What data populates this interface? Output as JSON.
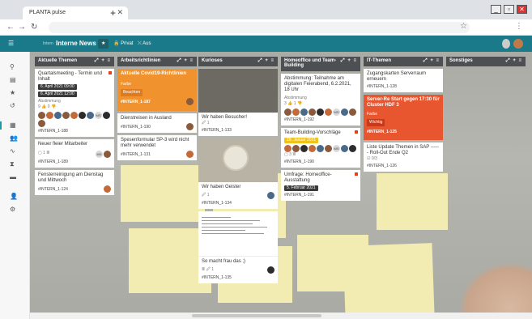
{
  "browser": {
    "tab_title": "PLANTA pulse",
    "tab_close": "✕",
    "new_tab": "+",
    "win_min": "_",
    "win_max": "▫",
    "win_close": "✕"
  },
  "app": {
    "breadcrumb_small": "Intern",
    "breadcrumb_main": "Interne News",
    "star": "★",
    "chip_privat": "🔒 Privat",
    "chip_aus": "⤬ Aus"
  },
  "colors": {
    "header": "#1a7a8a",
    "lane_head": "#4e4f52",
    "orange_card": "#f0922e",
    "red_card": "#e85630"
  },
  "lanes": [
    {
      "title": "Aktuelle Themen",
      "tools": "⤢ + ≡",
      "cards": [
        {
          "title": "Quartalsmeeting - Termin und Inhalt",
          "date1": "6. April 2021 09:00",
          "date2": "6. April 2021 12:00",
          "vote_label": "Abstimmung",
          "votes": "9 👍 0 👎",
          "id": "#INTERN_1-188"
        },
        {
          "title": "Neuer fleier Mitarbeiter",
          "meta": "▢ 1 ≣",
          "id": "#INTERN_1-189"
        },
        {
          "title": "Fensterreinigung am Dienstag und Mittwoch",
          "id": "#INTERN_1-124"
        }
      ]
    },
    {
      "title": "Arbeitsrichtlinien",
      "tools": "⤢ + ≡",
      "cards": [
        {
          "title": "Aktuelle Covid19-Richtlinien",
          "tag_label": "Farbe",
          "tag": "Beachten",
          "id": "#INTERN_1-187"
        },
        {
          "title": "Dienstreisen in Ausland",
          "id": "#INTERN_1-190"
        },
        {
          "title": "Spesenformular SP-3 wird nicht mehr verwendet",
          "id": "#INTERN_1-131"
        }
      ]
    },
    {
      "title": "Kurioses",
      "tools": "⤢ + ≡",
      "cards": [
        {
          "title": "Wir haben Besucher!",
          "meta": "🖉 1",
          "id": "#INTERN_1-133"
        },
        {
          "title": "Wir haben Geister",
          "meta": "🖉 1",
          "id": "#INTERN_1-134"
        },
        {
          "title": "So macht frau das ;)",
          "meta": "≣ 🖉 1",
          "id": "#INTERN_1-135"
        }
      ]
    },
    {
      "title": "Homeoffice und Team-Building",
      "tools": "⤢ + ≡",
      "cards": [
        {
          "title": "Abstimmung: Teilnahme am digitalen Feierabend, 6.2.2021, 18 Uhr",
          "vote_label": "Abstimmung",
          "votes": "3 👍 1 👎",
          "id": "#INTERN_1-192"
        },
        {
          "title": "Team-Building-Vorschläge",
          "date1": "28. Januar 2021",
          "meta": "▢ 3 ≣",
          "id": "#INTERN_1-190"
        },
        {
          "title": "Umfrage: Homeoffice-Ausstattung",
          "date1": "5. Februar 2021",
          "id": "#INTERN_1-191"
        }
      ]
    },
    {
      "title": "IT-Themen",
      "tools": "⤢ + ≡",
      "cards": [
        {
          "title": "Zugangskarten Serverraum erneuern",
          "id": "#INTERN_1-128"
        },
        {
          "title": "Server-Re Start gegen 17:30 für Cluster HDF 3",
          "tag_label": "Farbe",
          "tag": "Wichtig",
          "id": "#INTERN_1-125"
        },
        {
          "title": "Liste Update Themen in SAP ------ Roll-Out Ende Q2",
          "meta": "☑ 0/3",
          "id": "#INTERN_1-126"
        }
      ]
    },
    {
      "title": "Sonstiges",
      "tools": "⤢ + ≡",
      "cards": []
    }
  ]
}
